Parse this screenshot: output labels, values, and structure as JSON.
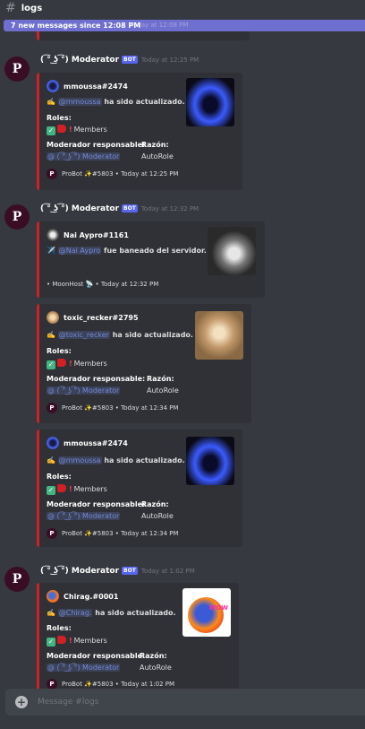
{
  "channel": {
    "name": "logs"
  },
  "new_messages": {
    "label": "7 new messages since 12:08 PM",
    "faint": "Today at 12:08 PM"
  },
  "messages": [
    {
      "username": "( ͡° ͜ʖ ͡°) Moderator",
      "badge": "BOT",
      "timestamp": "Today at 12:25 PM",
      "embeds": [
        {
          "author": "mmoussa#2474",
          "mention": "@mmoussa",
          "action": "ha sido actualizado.",
          "roles_label": "Roles:",
          "roles_value": "Members",
          "moderator_label": "Moderador responsable:",
          "moderator_value": "@ ( ͡° ͜ʖ ͡°) Moderator",
          "reason_label": "Razón:",
          "reason_value": "AutoRole",
          "footer": "ProBot ✨#5803 • Today at 12:25 PM"
        }
      ]
    },
    {
      "username": "( ͡° ͜ʖ ͡°) Moderator",
      "badge": "BOT",
      "timestamp": "Today at 12:32 PM",
      "embeds": [
        {
          "author": "Nai Aypro#1161",
          "mention": "@Nai Aypro",
          "action": "fue baneado del servidor.",
          "footer": "• MoonHost 📡 • Today at 12:32 PM"
        },
        {
          "author": "toxic_recker#2795",
          "mention": "@toxic_recker",
          "action": "ha sido actualizado.",
          "roles_label": "Roles:",
          "roles_value": "Members",
          "moderator_label": "Moderador responsable:",
          "moderator_value": "@ ( ͡° ͜ʖ ͡°) Moderator",
          "reason_label": "Razón:",
          "reason_value": "AutoRole",
          "footer": "ProBot ✨#5803 • Today at 12:34 PM"
        },
        {
          "author": "mmoussa#2474",
          "mention": "@mmoussa",
          "action": "ha sido actualizado.",
          "roles_label": "Roles:",
          "roles_value": "Members",
          "moderator_label": "Moderador responsable:",
          "moderator_value": "@ ( ͡° ͜ʖ ͡°) Moderator",
          "reason_label": "Razón:",
          "reason_value": "AutoRole",
          "footer": "ProBot ✨#5803 • Today at 12:34 PM"
        }
      ]
    },
    {
      "username": "( ͡° ͜ʖ ͡°) Moderator",
      "badge": "BOT",
      "timestamp": "Today at 1:02 PM",
      "embeds": [
        {
          "author": "Chirag.#0001",
          "mention": "@Chirag.",
          "action": "ha sido actualizado.",
          "roles_label": "Roles:",
          "roles_value": "Members",
          "moderator_label": "Moderador responsable:",
          "moderator_value": "@ ( ͡° ͜ʖ ͡°) Moderator",
          "reason_label": "Razón:",
          "reason_value": "AutoRole",
          "footer": "ProBot ✨#5803 • Today at 1:02 PM",
          "thumb_text": "WOW"
        }
      ]
    }
  ],
  "composer": {
    "placeholder": "Message #logs"
  },
  "colors": {
    "embed_border": "#d12026",
    "bot_badge": "#5865f2",
    "new_bar": "#6f6fcf",
    "mention": "#7289da"
  }
}
